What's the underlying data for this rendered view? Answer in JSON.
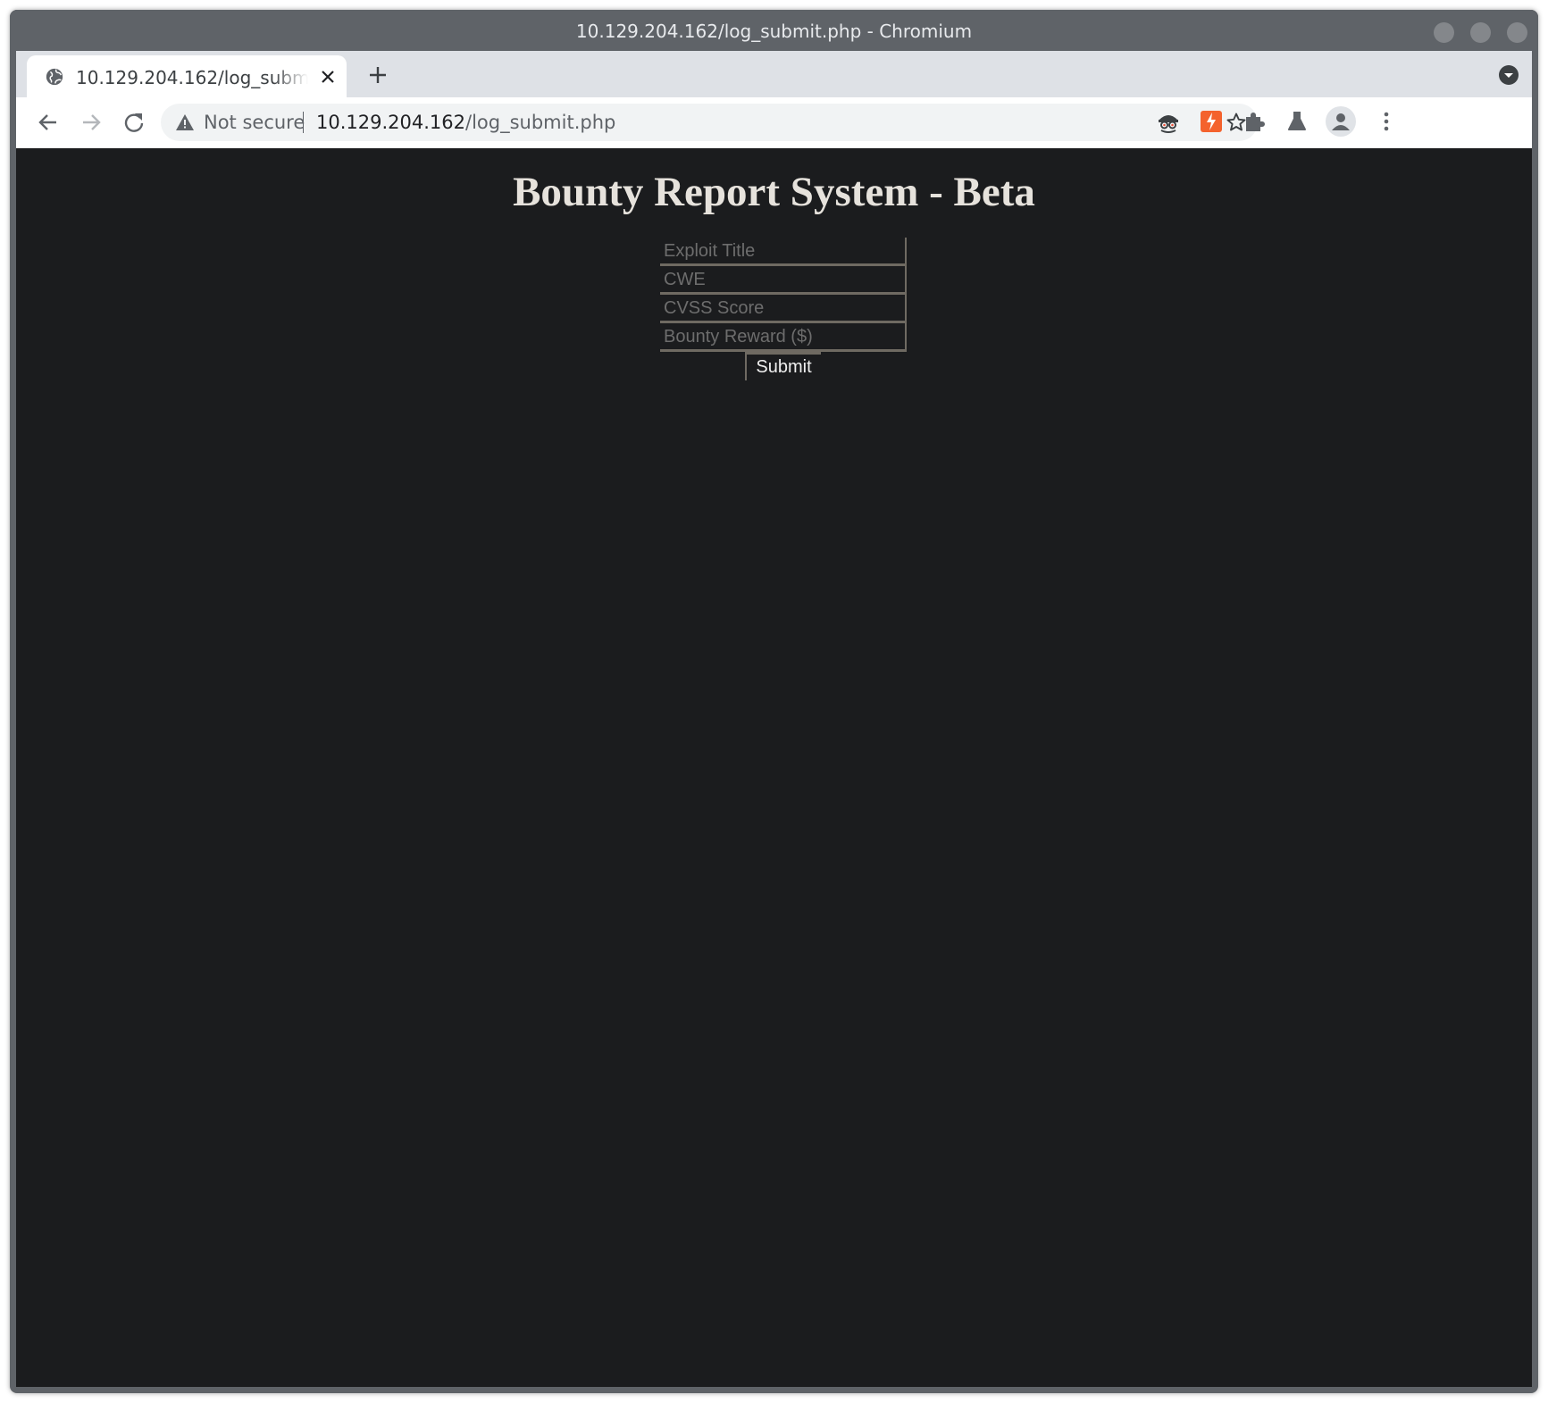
{
  "window": {
    "title": "10.129.204.162/log_submit.php - Chromium"
  },
  "tab": {
    "title": "10.129.204.162/log_submit.php"
  },
  "omnibox": {
    "security_label": "Not secure",
    "url_host": "10.129.204.162",
    "url_path": "/log_submit.php"
  },
  "page": {
    "heading": "Bounty Report System - Beta",
    "form": {
      "exploit_title_placeholder": "Exploit Title",
      "cwe_placeholder": "CWE",
      "cvss_placeholder": "CVSS Score",
      "reward_placeholder": "Bounty Reward ($)",
      "submit_label": "Submit"
    }
  },
  "colors": {
    "page_background": "#1b1c1e",
    "heading": "#e6e2dc",
    "field_border": "#6f6a62",
    "chrome_frame": "#5f6368"
  }
}
